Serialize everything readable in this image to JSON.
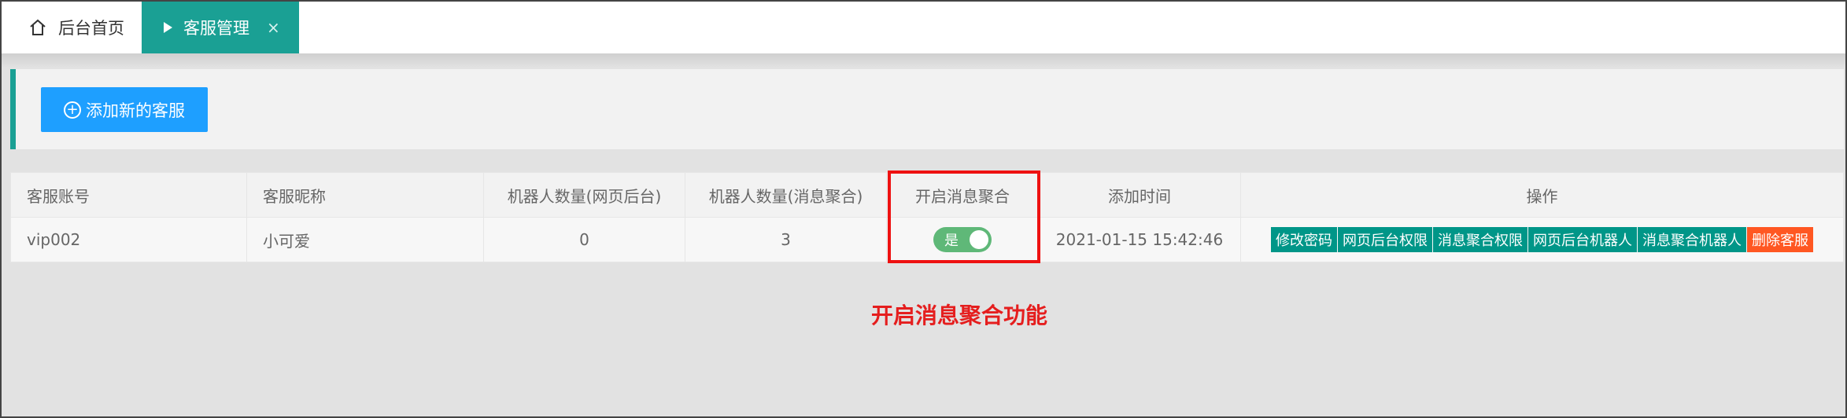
{
  "tabs": {
    "home_label": "后台首页",
    "active_label": "客服管理",
    "close_glyph": "×"
  },
  "toolbar": {
    "add_label": "添加新的客服",
    "add_icon": "plus-circle-icon"
  },
  "table": {
    "headers": [
      "客服账号",
      "客服昵称",
      "机器人数量(网页后台)",
      "机器人数量(消息聚合)",
      "开启消息聚合",
      "添加时间",
      "操作"
    ],
    "rows": [
      {
        "account": "vip002",
        "nickname": "小可爱",
        "robots_web": "0",
        "robots_msg": "3",
        "aggregation_switch": "是",
        "added_time": "2021-01-15 15:42:46",
        "actions": [
          "修改密码",
          "网页后台权限",
          "消息聚合权限",
          "网页后台机器人",
          "消息聚合机器人",
          "删除客服"
        ]
      }
    ]
  },
  "annotation": {
    "text": "开启消息聚合功能"
  },
  "colors": {
    "accent": "#1aa094",
    "primary": "#1e9fff",
    "switch_on": "#5fb878",
    "action": "#009688",
    "danger": "#ff5722",
    "annotation": "#e51e1e"
  }
}
